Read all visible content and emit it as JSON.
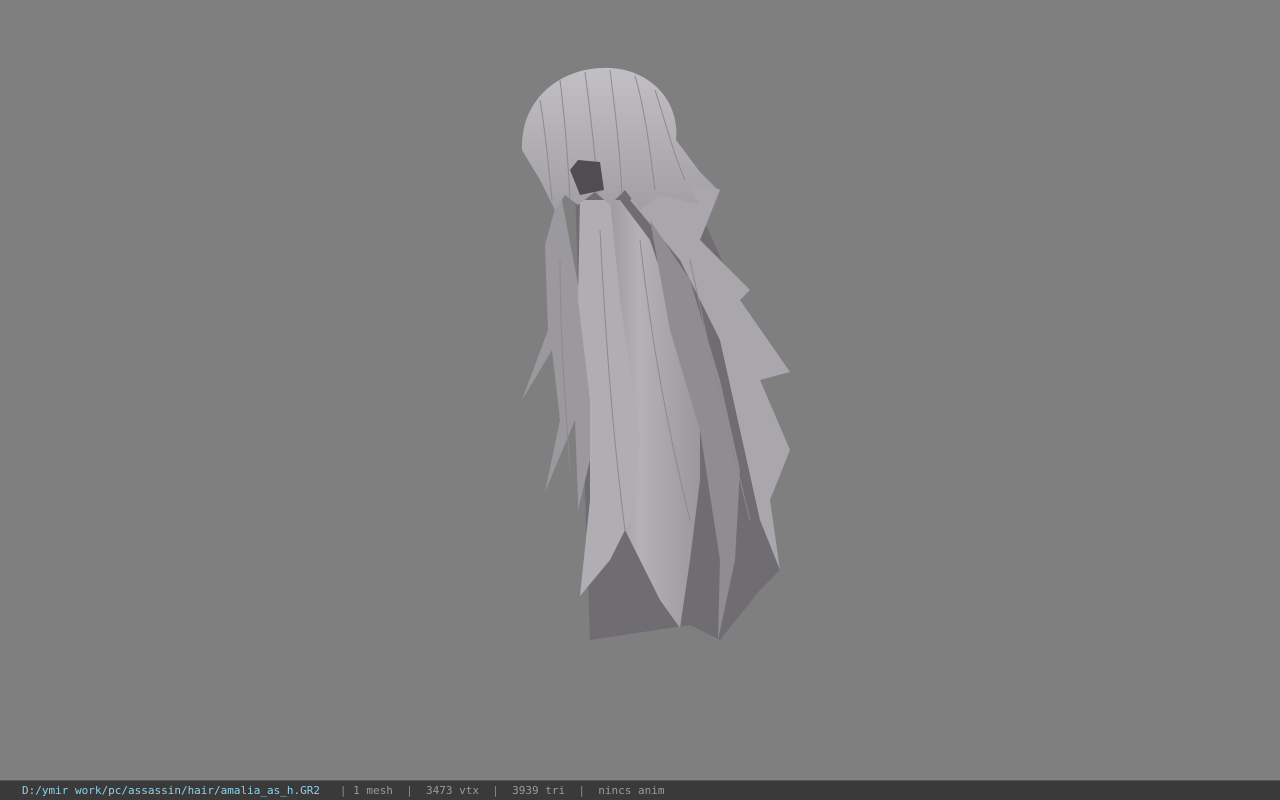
{
  "viewer": {
    "background_color": "#7f7f7f",
    "model_color": "#a5a3a7",
    "model_shadow_color": "#6c6a6e",
    "model_highlight_color": "#bdbbbf",
    "model_icon": "hair-mesh-icon"
  },
  "status": {
    "file_path": "D:/ymir work/pc/assassin/hair/amalia_as_h.GR2",
    "separator": "|",
    "mesh_count": "1 mesh",
    "vertex_count": "3473 vtx",
    "triangle_count": "3939 tri",
    "animation": "nincs anim",
    "path_color": "#8fd0e6",
    "bar_color": "#3a3a3a"
  }
}
